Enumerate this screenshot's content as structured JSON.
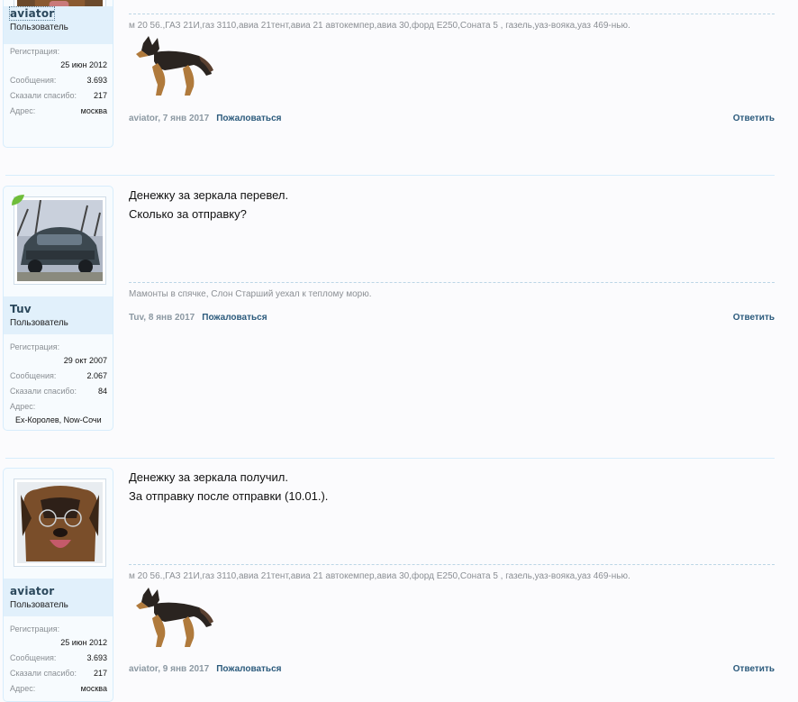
{
  "colors": {
    "link": "#2b5a7c",
    "band": "#e1f0fb",
    "border": "#d7edfc",
    "muted": "#8b8f94"
  },
  "posts": [
    {
      "author": "aviator",
      "title": "Пользователь",
      "stats": [
        {
          "label": "Регистрация:",
          "value": "25 июн 2012"
        },
        {
          "label": "Сообщения:",
          "value": "3.693"
        },
        {
          "label": "Сказали спасибо:",
          "value": "217"
        },
        {
          "label": "Адрес:",
          "value": "москва"
        }
      ],
      "signature": "м 20 56.,ГАЗ 21И,газ 3110,авиа 21тент,авиа 21 автокемпер,авиа 30,форд Е250,Соната 5 , газель,уаз-вояка,уаз 469-нью.",
      "meta": "aviator, 7 янв 2017",
      "report": "Пожаловаться",
      "reply": "Ответить"
    },
    {
      "author": "Tuv",
      "title": "Пользователь",
      "stats": [
        {
          "label": "Регистрация:",
          "value": "29 окт 2007"
        },
        {
          "label": "Сообщения:",
          "value": "2.067"
        },
        {
          "label": "Сказали спасибо:",
          "value": "84"
        },
        {
          "label": "Адрес:",
          "value": "Ex-Королев, Now-Сочи"
        }
      ],
      "message": [
        "Денежку за зеркала перевел.",
        "Сколько за отправку?"
      ],
      "signature": "Мамонты в спячке, Слон Старший уехал к теплому морю.",
      "meta": "Tuv, 8 янв 2017",
      "report": "Пожаловаться",
      "reply": "Ответить"
    },
    {
      "author": "aviator",
      "title": "Пользователь",
      "stats": [
        {
          "label": "Регистрация:",
          "value": "25 июн 2012"
        },
        {
          "label": "Сообщения:",
          "value": "3.693"
        },
        {
          "label": "Сказали спасибо:",
          "value": "217"
        },
        {
          "label": "Адрес:",
          "value": "москва"
        }
      ],
      "message": [
        "Денежку за зеркала получил.",
        "За отправку после отправки (10.01.)."
      ],
      "signature": "м 20 56.,ГАЗ 21И,газ 3110,авиа 21тент,авиа 21 автокемпер,авиа 30,форд Е250,Соната 5 , газель,уаз-вояка,уаз 469-нью.",
      "meta": "aviator, 9 янв 2017",
      "report": "Пожаловаться",
      "reply": "Ответить"
    }
  ]
}
